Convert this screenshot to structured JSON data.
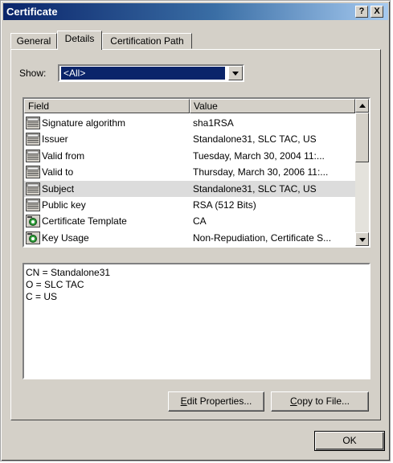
{
  "window": {
    "title": "Certificate"
  },
  "titlebar_buttons": {
    "help": "?",
    "close": "X"
  },
  "tabs": [
    {
      "label": "General"
    },
    {
      "label": "Details"
    },
    {
      "label": "Certification Path"
    }
  ],
  "show": {
    "label": "Show:",
    "value": "<All>"
  },
  "list": {
    "headers": {
      "field": "Field",
      "value": "Value"
    },
    "rows": [
      {
        "field": "Signature algorithm",
        "value": "sha1RSA",
        "icon": "certificate-field-icon"
      },
      {
        "field": "Issuer",
        "value": "Standalone31, SLC TAC, US",
        "icon": "certificate-field-icon"
      },
      {
        "field": "Valid from",
        "value": "Tuesday, March 30, 2004 11:...",
        "icon": "certificate-field-icon"
      },
      {
        "field": "Valid to",
        "value": "Thursday, March 30, 2006 11:...",
        "icon": "certificate-field-icon"
      },
      {
        "field": "Subject",
        "value": "Standalone31, SLC TAC, US",
        "icon": "certificate-field-icon",
        "selected": true
      },
      {
        "field": "Public key",
        "value": "RSA (512 Bits)",
        "icon": "certificate-field-icon"
      },
      {
        "field": "Certificate Template",
        "value": "CA",
        "icon": "certificate-extension-icon"
      },
      {
        "field": "Key Usage",
        "value": "Non-Repudiation, Certificate S...",
        "icon": "certificate-extension-icon"
      }
    ]
  },
  "detail_lines": [
    "CN = Standalone31",
    "O = SLC TAC",
    "C = US"
  ],
  "buttons": {
    "edit_properties": {
      "prefix": "",
      "mnemonic": "E",
      "rest": "dit Properties..."
    },
    "copy_to_file": {
      "prefix": "",
      "mnemonic": "C",
      "rest": "opy to File..."
    },
    "ok": "OK"
  },
  "colors": {
    "dialog_face": "#d4d0c8",
    "title_gradient_start": "#0a246a",
    "selection": "#0a246a",
    "selected_row": "#dcdcdc"
  }
}
